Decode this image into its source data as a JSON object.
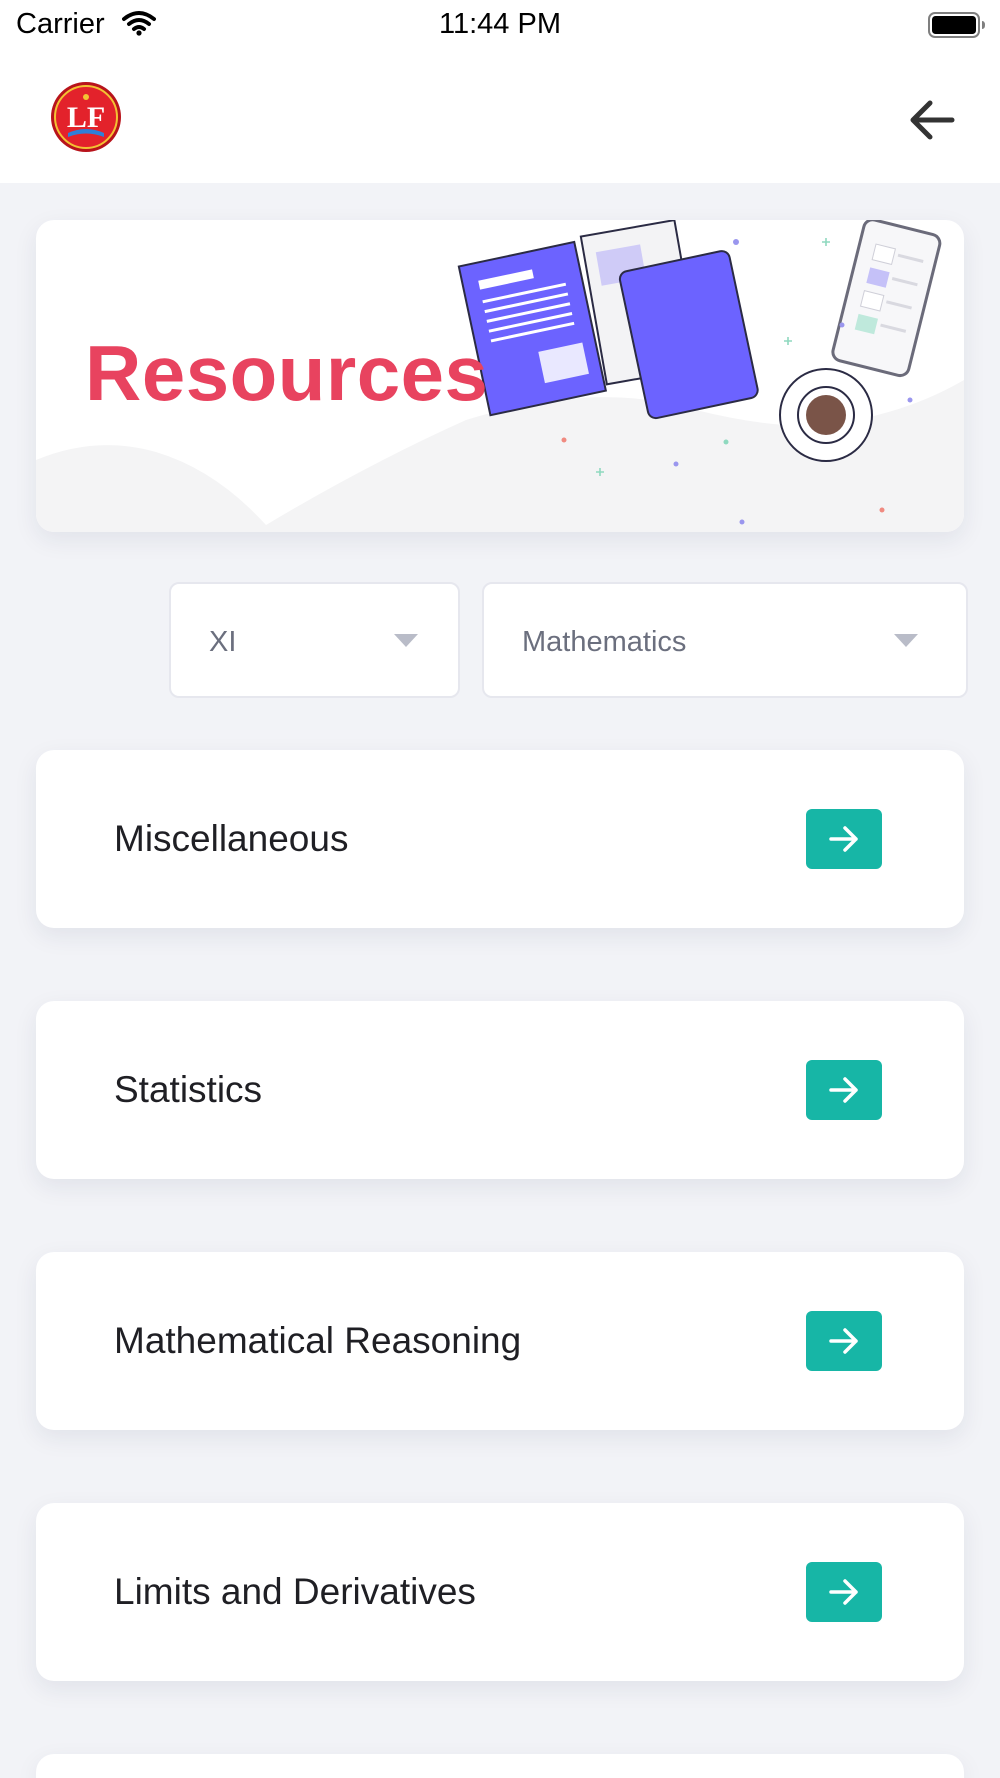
{
  "status_bar": {
    "carrier": "Carrier",
    "time": "11:44 PM"
  },
  "header": {
    "logo_icon": "lf-school-logo-icon",
    "back_icon": "arrow-left-icon"
  },
  "banner": {
    "title": "Resources",
    "title_color": "#e8435f"
  },
  "filters": {
    "class_value": "XI",
    "subject_value": "Mathematics"
  },
  "topics": [
    {
      "label": "Miscellaneous"
    },
    {
      "label": "Statistics"
    },
    {
      "label": "Mathematical Reasoning"
    },
    {
      "label": "Limits and Derivatives"
    }
  ],
  "colors": {
    "accent": "#17b6a6",
    "background": "#f2f3f7",
    "illustration": "#6c63ff"
  }
}
